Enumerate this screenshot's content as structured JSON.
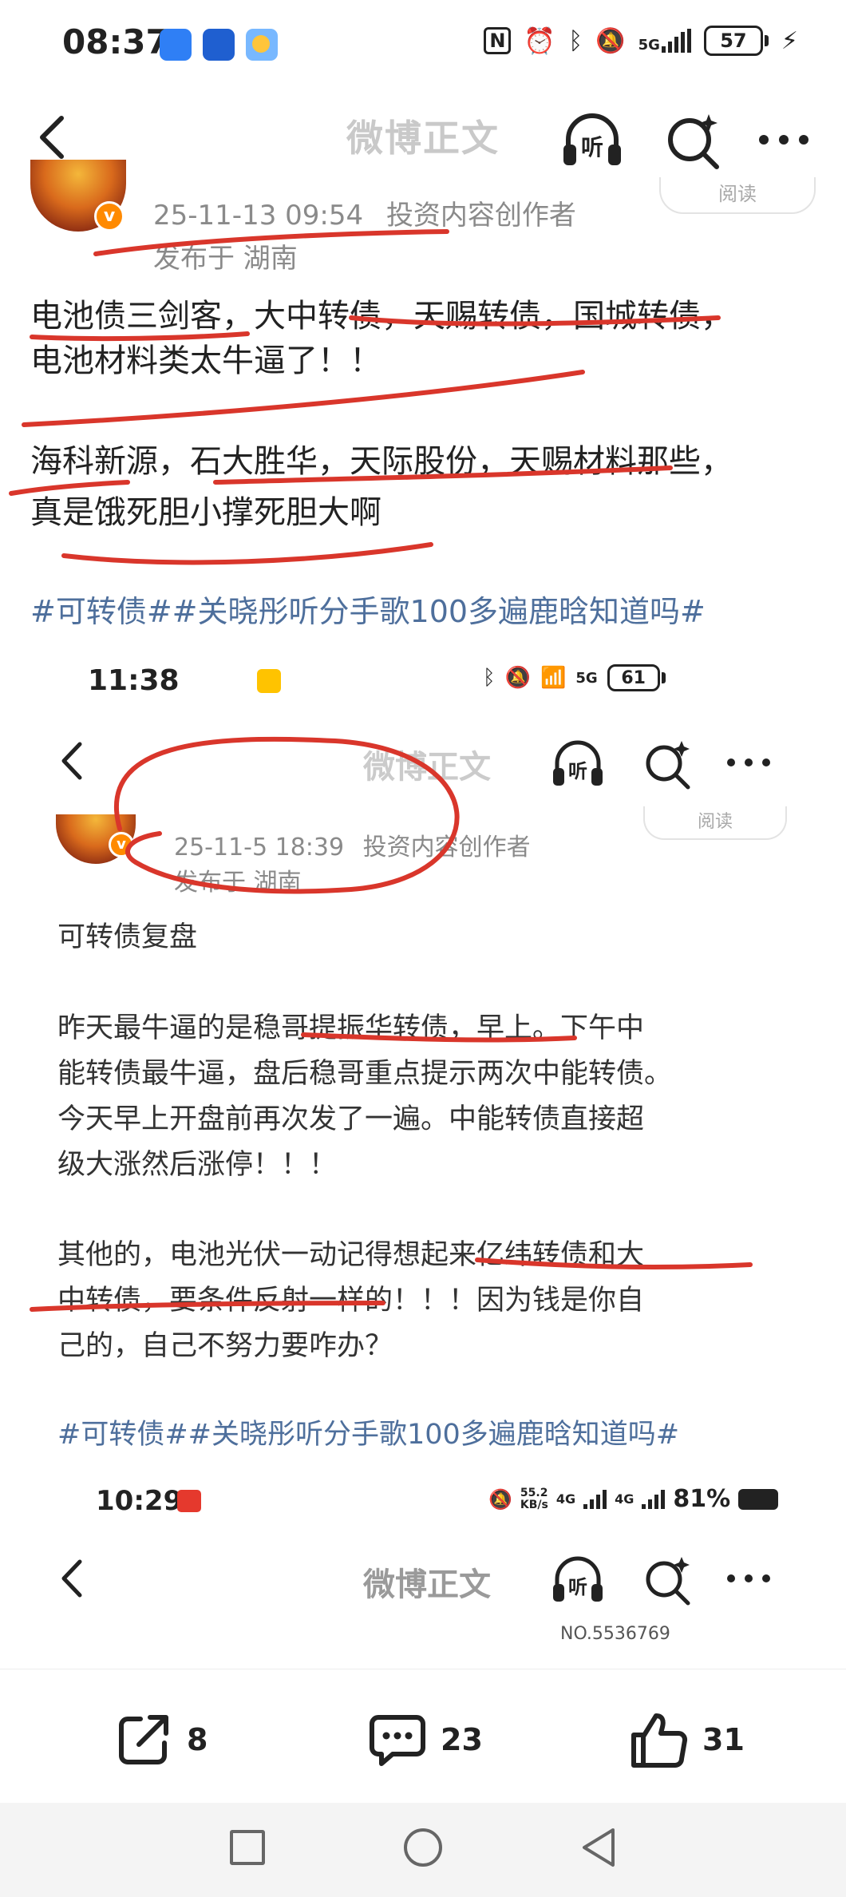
{
  "status_bar": {
    "time": "08:37",
    "network": "5G",
    "battery": "57",
    "icons": [
      "nfc-icon",
      "alarm-icon",
      "bluetooth-icon",
      "mute-icon",
      "signal-icon",
      "charging-icon"
    ]
  },
  "nav": {
    "title": "微博正文",
    "listen_label": "听"
  },
  "post": {
    "header_date": "25-11-13 09:54",
    "header_role": "投资内容创作者",
    "location": "发布于 湖南",
    "read_label": "阅读",
    "line1": "电池债三剑客，大中转债，天赐转债，国城转债，",
    "line2": "电池材料类太牛逼了！！",
    "line3": "海科新源，石大胜华，天际股份，天赐材料那些，",
    "line4": "真是饿死胆小撑死胆大啊",
    "hashtags": "#可转债##关晓彤听分手歌100多遍鹿晗知道吗#"
  },
  "screenshot1": {
    "time": "11:38",
    "battery": "61",
    "network": "5G",
    "title": "微博正文",
    "listen_label": "听",
    "header_date": "25-11-5 18:39",
    "header_role": "投资内容创作者",
    "location": "发布于 湖南",
    "read_label": "阅读",
    "p_title": "可转债复盘",
    "p1_l1": "昨天最牛逼的是稳哥提振华转债，早上。下午中",
    "p1_l2": "能转债最牛逼，盘后稳哥重点提示两次中能转债。",
    "p1_l3": "今天早上开盘前再次发了一遍。中能转债直接超",
    "p1_l4": "级大涨然后涨停！！！",
    "p2_l1": "其他的，电池光伏一动记得想起来亿纬转债和大",
    "p2_l2": "中转债，要条件反射一样的！！！因为钱是你自",
    "p2_l3": "己的，自己不努力要咋办？",
    "hashtags": "#可转债##关晓彤听分手歌100多遍鹿晗知道吗#"
  },
  "screenshot2": {
    "time": "10:29",
    "speed_value": "55.2",
    "speed_unit": "KB/s",
    "network_a": "4G",
    "network_b": "4G",
    "battery": "81%",
    "title": "微博正文",
    "listen_label": "听",
    "badge": "NO.5536769"
  },
  "actions": {
    "share_count": "8",
    "comment_count": "23",
    "like_count": "31"
  },
  "colors": {
    "ink_red": "#d9362b",
    "hashtag_blue": "#4e6f9c",
    "title_gray": "#c9c9c9",
    "text": "#222222"
  }
}
